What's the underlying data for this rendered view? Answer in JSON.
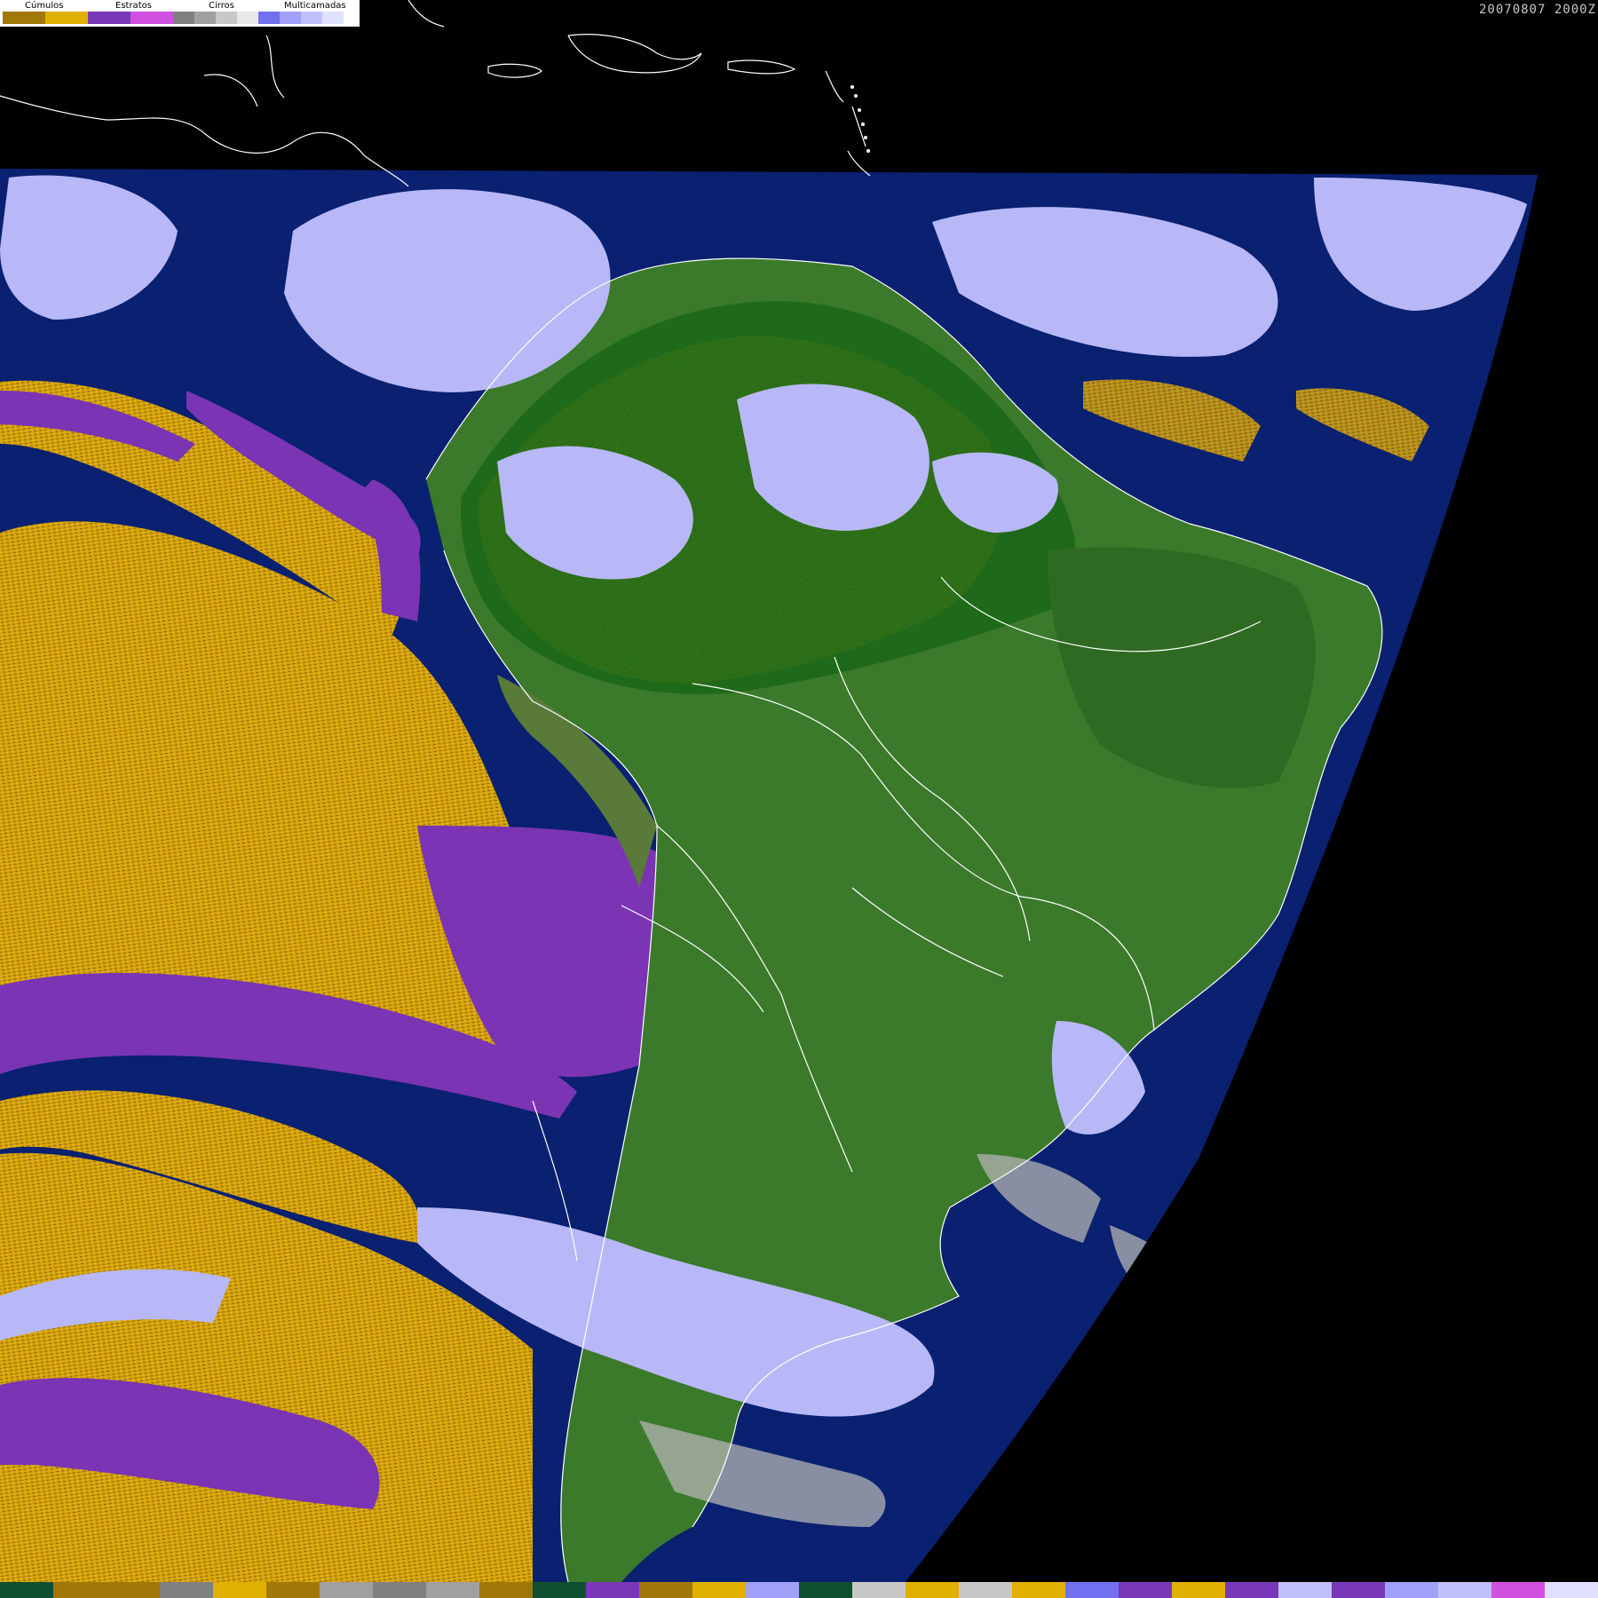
{
  "legend": {
    "categories": [
      {
        "label": "Cúmulos",
        "colors": [
          "#a07808",
          "#e0b000"
        ]
      },
      {
        "label": "Estratos",
        "colors": [
          "#7838b8",
          "#d050e0"
        ]
      },
      {
        "label": "Cirros",
        "colors": [
          "#808080",
          "#a0a0a0",
          "#c8c8c8",
          "#e8e8e8"
        ]
      },
      {
        "label": "Multicamadas",
        "colors": [
          "#7070f0",
          "#a0a0f8",
          "#c0c0ff",
          "#e0e0ff"
        ]
      }
    ]
  },
  "timestamp": "20070807 2000Z",
  "colors": {
    "ocean": "#0a2070",
    "space": "#000000",
    "land": "#3a7a2a",
    "forest": "#1f6a1a",
    "cumulus": "#d4a20a",
    "stratus": "#7a34b4",
    "cirrus": "#b4b4b4",
    "multilayer": "#b8b8f8",
    "coastline": "#ffffff"
  },
  "bottom_bar": [
    "#105030",
    "#a07808",
    "#a07808",
    "#808080",
    "#e0b000",
    "#a07808",
    "#a0a0a0",
    "#808080",
    "#a0a0a0",
    "#a07808",
    "#105030",
    "#7838b8",
    "#a07808",
    "#e0b000",
    "#a0a0f8",
    "#105030",
    "#c8c8c8",
    "#e0b000",
    "#c8c8c8",
    "#e0b000",
    "#7070f0",
    "#7838b8",
    "#e0b000",
    "#7838b8",
    "#c0c0ff",
    "#7838b8",
    "#a0a0f8",
    "#c0c0ff",
    "#d050e0",
    "#e0e0ff"
  ]
}
